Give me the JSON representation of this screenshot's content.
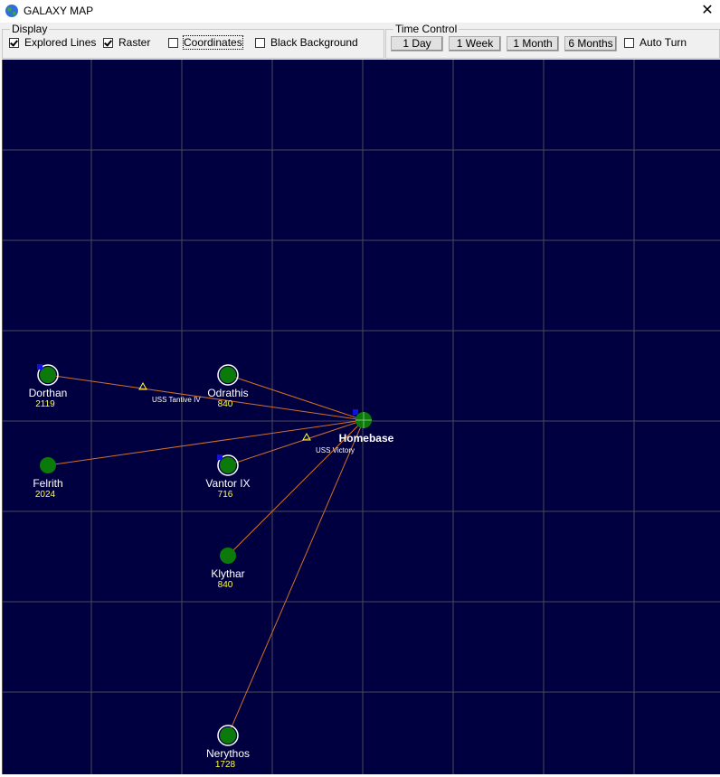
{
  "window": {
    "title": "GALAXY MAP",
    "close_glyph": "✕"
  },
  "display": {
    "legend": "Display",
    "explored_lines": {
      "label": "Explored Lines",
      "checked": true
    },
    "raster": {
      "label": "Raster",
      "checked": true
    },
    "coordinates": {
      "label": "Coordinates",
      "checked": false
    },
    "black_background": {
      "label": "Black Background",
      "checked": false
    }
  },
  "time_control": {
    "legend": "Time Control",
    "buttons": [
      "1 Day",
      "1 Week",
      "1 Month",
      "6 Months"
    ],
    "auto_turn": {
      "label": "Auto Turn",
      "checked": false
    }
  },
  "colors": {
    "map_background": "#000040",
    "grid": "#4a4a5a",
    "route": "#d07028",
    "planet": "#0b7a0b",
    "ring": "#ffffff",
    "fleet": "#1010e0",
    "value_text": "#ffff40",
    "ship": "#ffff40"
  },
  "map": {
    "homebase": {
      "name": "Homebase"
    },
    "planets": [
      {
        "name": "Dorthan",
        "value": "2119",
        "fleet": true
      },
      {
        "name": "Odrathis",
        "value": "840",
        "fleet": false
      },
      {
        "name": "Felrith",
        "value": "2024",
        "fleet": false
      },
      {
        "name": "Vantor IX",
        "value": "716",
        "fleet": true
      },
      {
        "name": "Klythar",
        "value": "840",
        "fleet": false
      },
      {
        "name": "Nerythos",
        "value": "1728",
        "fleet": false
      }
    ],
    "ships": [
      {
        "name": "USS Tantive IV"
      },
      {
        "name": "USS Victory"
      }
    ]
  }
}
